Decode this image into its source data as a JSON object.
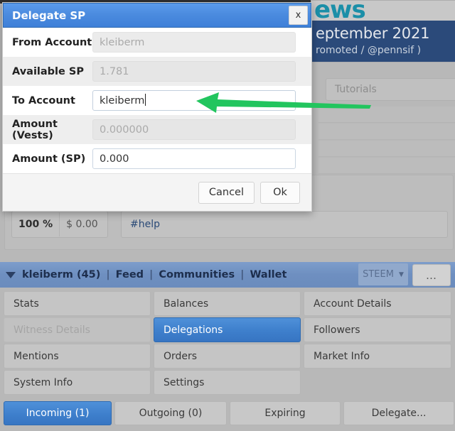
{
  "dialog": {
    "title": "Delegate SP",
    "close_label": "x",
    "rows": [
      {
        "label": "From Account",
        "value": "kleiberm",
        "state": "readonly"
      },
      {
        "label": "Available SP",
        "value": "1.781",
        "state": "readonly"
      },
      {
        "label": "To Account",
        "value": "kleiberm",
        "state": "focused"
      },
      {
        "label": "Amount (Vests)",
        "value": "0.000000",
        "state": "readonly"
      },
      {
        "label": "Amount (SP)",
        "value": "0.000",
        "state": "editable"
      }
    ],
    "cancel_label": "Cancel",
    "ok_label": "Ok"
  },
  "background": {
    "news": {
      "logo_text": "ews",
      "title": "eptember 2021",
      "subtitle": "romoted / @pennsif )"
    },
    "tutorials_label": "Tutorials",
    "post": {
      "vote_percent": "100 %",
      "vote_amount": "$ 0.00",
      "tag": "#help"
    }
  },
  "navbar": {
    "account": "kleiberm (45)",
    "sep": "|",
    "links": [
      "Feed",
      "Communities",
      "Wallet"
    ],
    "token": "STEEM",
    "token_caret": "▼",
    "more_label": "…"
  },
  "menu": {
    "cells": [
      {
        "label": "Stats",
        "state": "normal"
      },
      {
        "label": "Balances",
        "state": "normal"
      },
      {
        "label": "Account Details",
        "state": "normal"
      },
      {
        "label": "Witness Details",
        "state": "disabled"
      },
      {
        "label": "Delegations",
        "state": "active"
      },
      {
        "label": "Followers",
        "state": "normal"
      },
      {
        "label": "Mentions",
        "state": "normal"
      },
      {
        "label": "Orders",
        "state": "normal"
      },
      {
        "label": "Market Info",
        "state": "normal"
      },
      {
        "label": "System Info",
        "state": "normal"
      },
      {
        "label": "Settings",
        "state": "normal"
      },
      {
        "label": "",
        "state": "empty"
      }
    ]
  },
  "tabs": [
    {
      "label": "Incoming (1)",
      "active": true
    },
    {
      "label": "Outgoing (0)",
      "active": false
    },
    {
      "label": "Expiring",
      "active": false
    },
    {
      "label": "Delegate...",
      "active": false
    }
  ],
  "annotation": {
    "arrow_color": "#22c55e",
    "direction": "left"
  },
  "colors": {
    "accent_blue": "#3e7fcc",
    "title_blue": "#4a8ade",
    "nav_blue": "#6e8fc0",
    "banner_navy": "#2b4a7a",
    "arrow_green": "#22c55e"
  }
}
